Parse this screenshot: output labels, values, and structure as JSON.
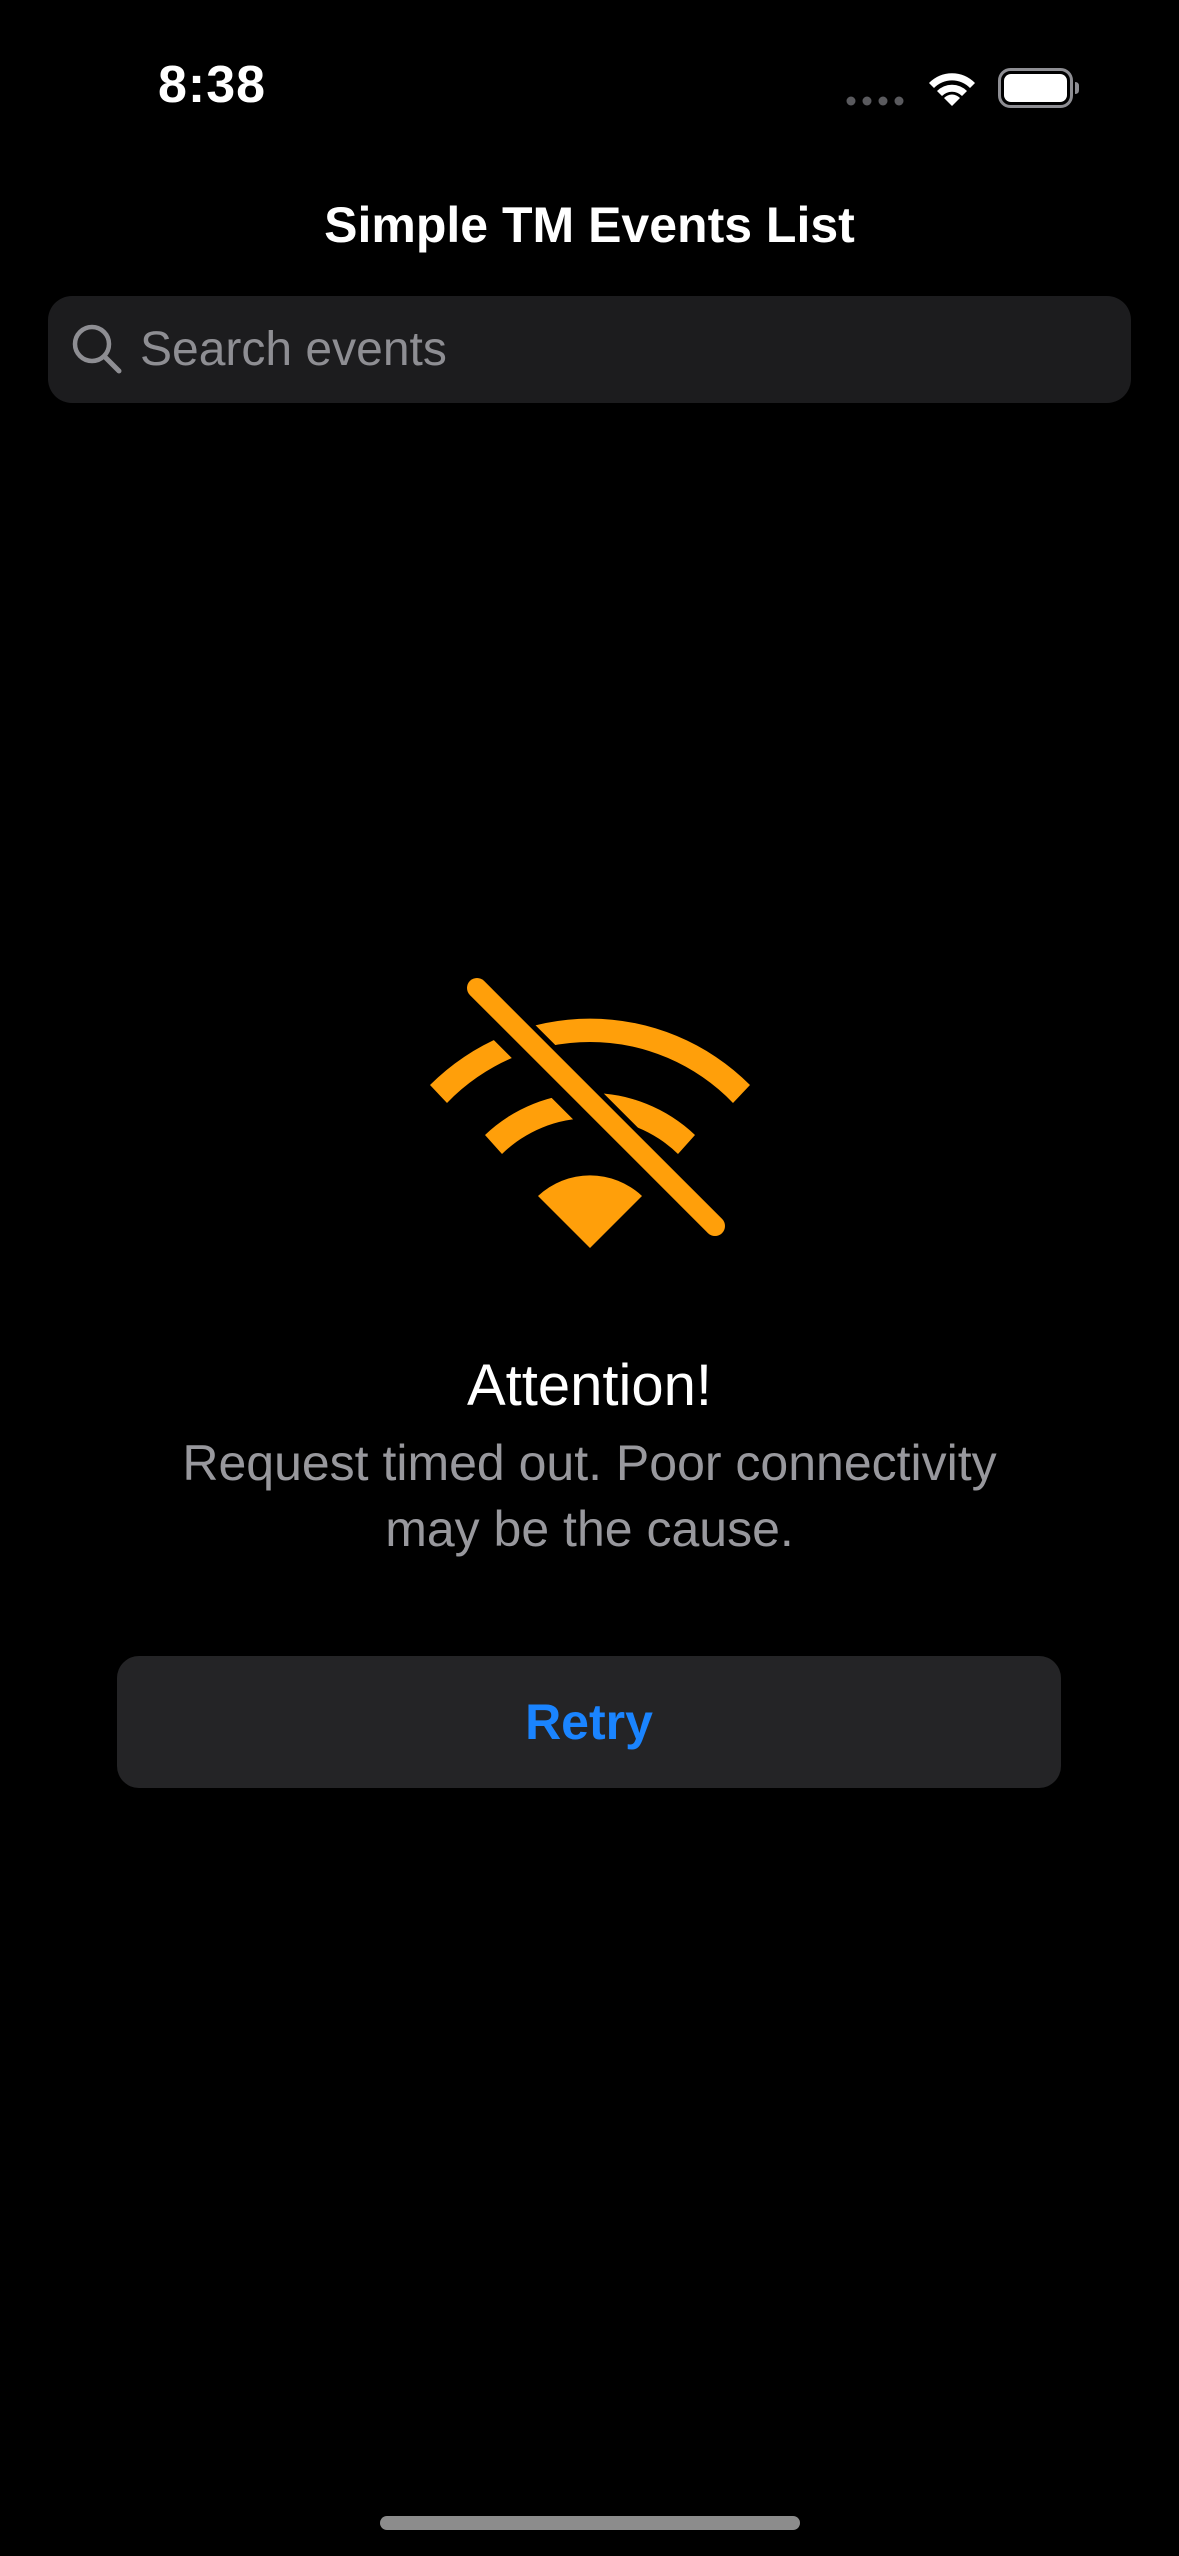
{
  "status_bar": {
    "time": "8:38",
    "icons": [
      "signal-dots-icon",
      "wifi-icon",
      "battery-icon"
    ]
  },
  "nav": {
    "title": "Simple TM Events List"
  },
  "search": {
    "placeholder": "Search events",
    "value": "",
    "icon": "search-icon"
  },
  "error_state": {
    "icon": "wifi-slash-icon",
    "title": "Attention!",
    "message": "Request timed out. Poor connectivity may be the cause.",
    "retry_label": "Retry"
  },
  "colors": {
    "background": "#000000",
    "accent": "#1a84ff",
    "warning": "#ff9f0a",
    "secondary_text": "#98989d",
    "surface": "#1c1c1e"
  }
}
